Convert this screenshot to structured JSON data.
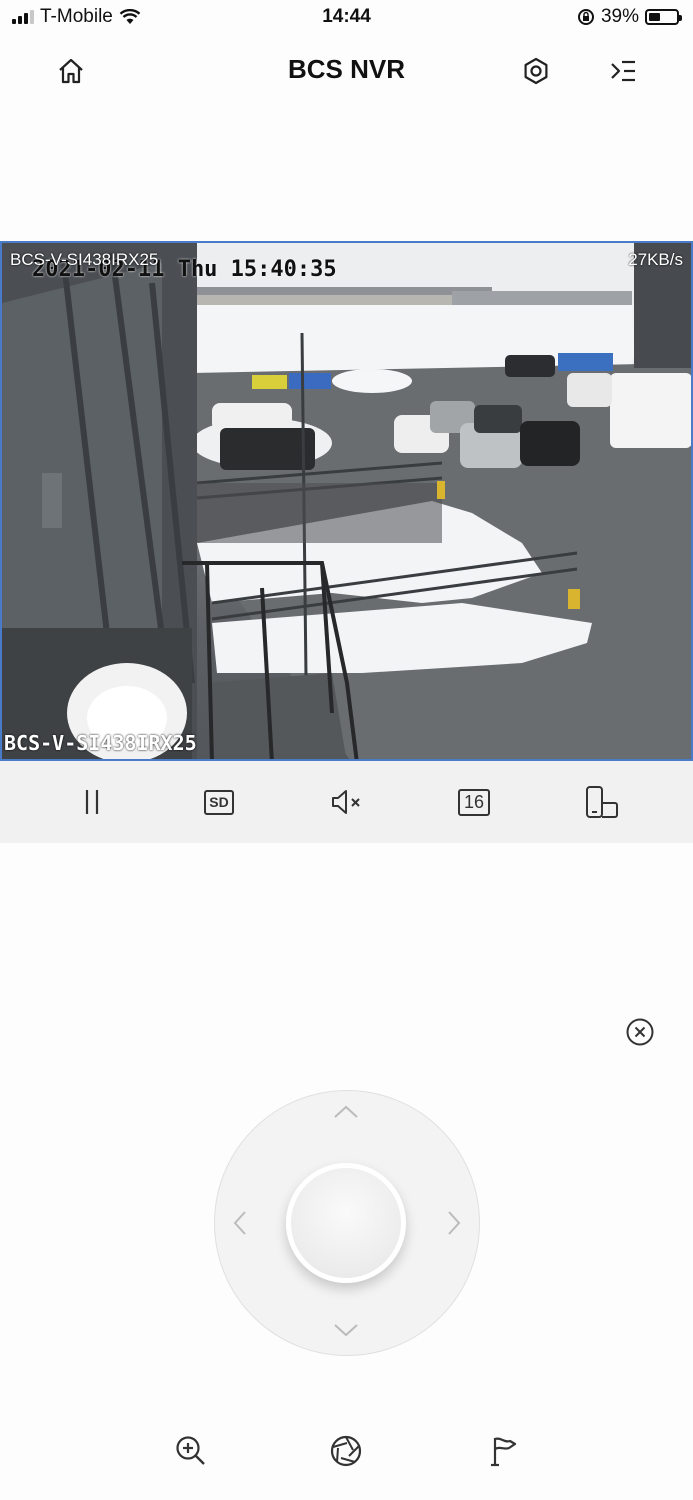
{
  "status_bar": {
    "carrier": "T-Mobile",
    "time": "14:44",
    "battery": "39%"
  },
  "header": {
    "title": "BCS NVR"
  },
  "video": {
    "camera_name_top": "BCS-V-SI438IRX25",
    "datetime_overlay": "2021-02-11 Thu 15:40:35",
    "bitrate": "27KB/s",
    "camera_name_bottom": "BCS-V-SI438IRX25"
  },
  "toolbar": {
    "quality_label": "SD",
    "split_label": "16"
  },
  "icons": {
    "home": "home-icon",
    "settings": "settings-icon",
    "menu": "menu-icon",
    "pause": "pause-icon",
    "mute": "mute-icon",
    "rotate": "rotate-icon",
    "close": "close-icon",
    "zoom": "zoom-in-icon",
    "iris": "iris-icon",
    "preset": "preset-flag-icon"
  }
}
